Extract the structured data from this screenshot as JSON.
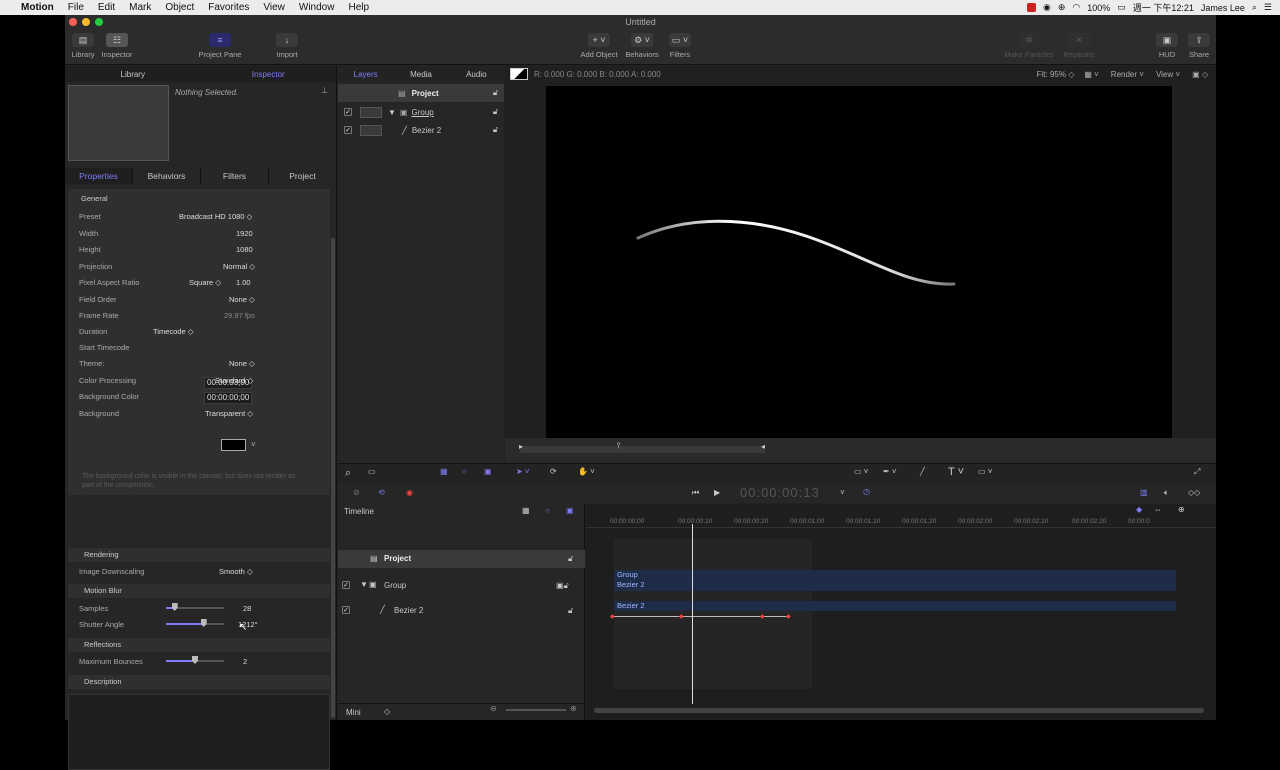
{
  "menubar": {
    "apple": "",
    "app": "Motion",
    "items": [
      "File",
      "Edit",
      "Mark",
      "Object",
      "Favorites",
      "View",
      "Window",
      "Help"
    ],
    "battery": "100%",
    "clock": "週一 下午12:21",
    "user": "James Lee"
  },
  "window": {
    "title": "Untitled"
  },
  "toolbar": {
    "library": "Library",
    "inspector": "Inspector",
    "project_pane": "Project Pane",
    "import": "Import",
    "add_object": "Add Object",
    "behaviors": "Behaviors",
    "filters": "Filters",
    "make_particles": "Make Particles",
    "replicate": "Replicate",
    "hud": "HUD",
    "share": "Share"
  },
  "left_tabs": {
    "library": "Library",
    "inspector": "Inspector"
  },
  "inspector": {
    "nothing_selected": "Nothing Selected.",
    "tabs": [
      "Properties",
      "Behaviors",
      "Filters",
      "Project"
    ],
    "general": "General",
    "preset_label": "Preset",
    "preset": "Broadcast HD 1080",
    "width_label": "Width",
    "width": "1920",
    "height_label": "Height",
    "height": "1080",
    "projection_label": "Projection",
    "projection": "Normal",
    "par_label": "Pixel Aspect Ratio",
    "par_mode": "Square",
    "par": "1.00",
    "field_label": "Field Order",
    "field": "None",
    "fps_label": "Frame Rate",
    "fps": "29.97 fps",
    "duration_label": "Duration",
    "duration_mode": "Timecode",
    "duration": "00:00:03;00",
    "start_label": "Start Timecode",
    "start": "00:00:00;00",
    "theme_label": "Theme:",
    "theme": "None",
    "color_label": "Color Processing",
    "color": "Standard",
    "bgcolor_label": "Background Color",
    "bg_label": "Background",
    "bg": "Transparent",
    "note": "The background color is visible in the canvas, but does not render as part of the composition.",
    "rendering": "Rendering",
    "downscale_label": "Image Downscaling",
    "downscale": "Smooth",
    "motion_blur": "Motion Blur",
    "samples_label": "Samples",
    "samples": "28",
    "samples_level": 0.15,
    "shutter_label": "Shutter Angle",
    "shutter": "1212°",
    "shutter_level": 0.65,
    "reflections": "Reflections",
    "bounces_label": "Maximum Bounces",
    "bounces": "2",
    "bounces_level": 0.5,
    "description": "Description"
  },
  "layer_tabs": [
    "Layers",
    "Media",
    "Audio"
  ],
  "layers": {
    "project": "Project",
    "group": "Group",
    "bezier": "Bezier 2"
  },
  "viewbar": {
    "rgba": "R: 0.000  G: 0.000  B: 0.000  A: 0.000",
    "fit": "Fit: 95%",
    "render": "Render",
    "view": "View"
  },
  "transport": {
    "timecode": "00:00:00:13"
  },
  "timeline": {
    "label": "Timeline",
    "project": "Project",
    "group": "Group",
    "bezier": "Bezier 2",
    "ticks": [
      "00:00:00;00",
      "00:00:00;10",
      "00:00:00;20",
      "00:00:01;00",
      "00:00:01;10",
      "00:00:01;20",
      "00:00:02;00",
      "00:00:02;10",
      "00:00:02;20",
      "00:00:0"
    ],
    "bar_group": "Group",
    "bar_bezier_a": "Bezier 2",
    "bar_bezier_b": "Bezier 2",
    "mini": "Mini"
  },
  "colors": {
    "accent": "#7f7cf5",
    "bar": "#27395f"
  }
}
